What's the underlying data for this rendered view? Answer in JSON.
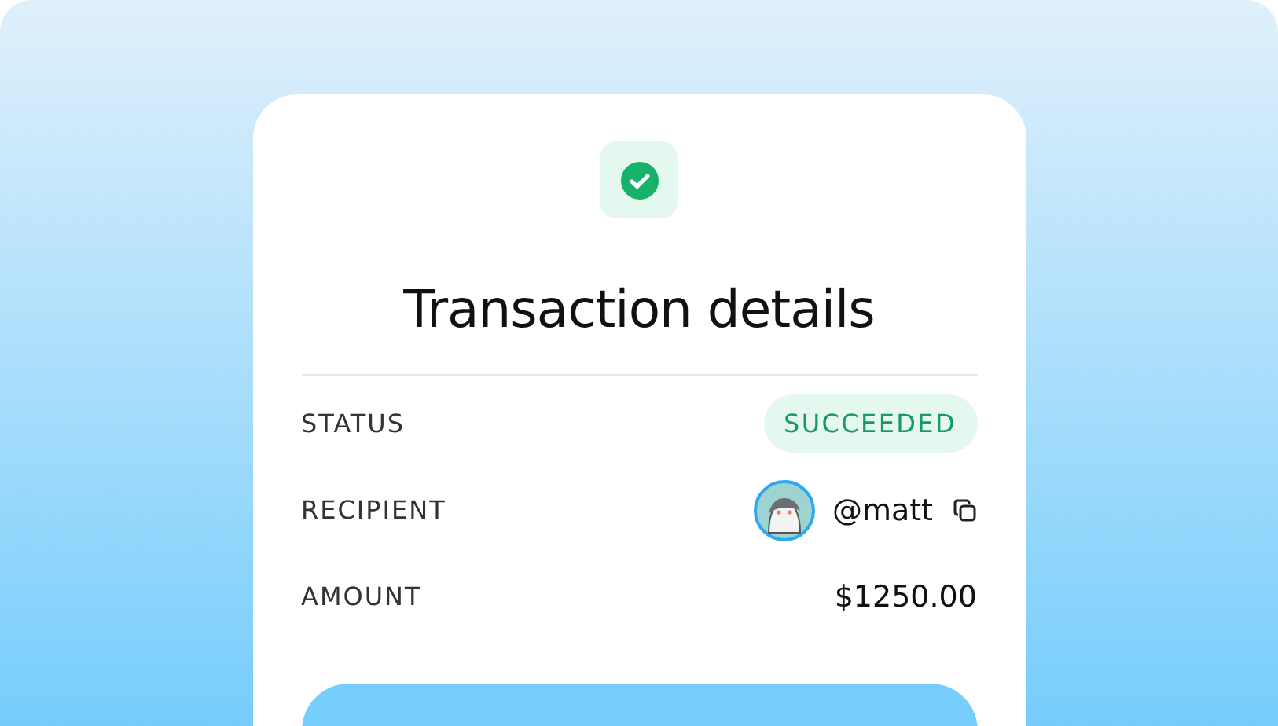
{
  "card": {
    "title": "Transaction details",
    "rows": [
      {
        "kind": "status",
        "label": "STATUS",
        "value": "SUCCEEDED"
      },
      {
        "kind": "user",
        "label": "RECIPIENT",
        "value": "@matt"
      },
      {
        "kind": "text",
        "label": "AMOUNT",
        "value": "$1250.00"
      }
    ]
  }
}
